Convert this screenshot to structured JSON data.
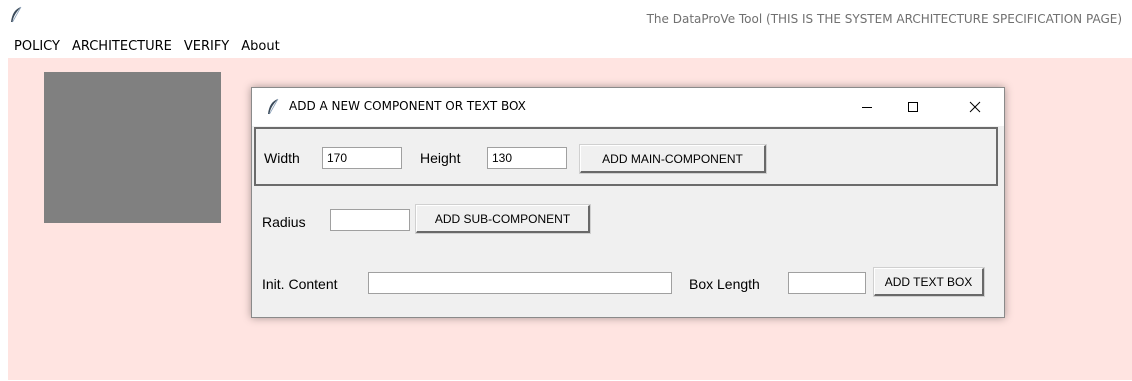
{
  "window": {
    "title": "The DataProVe Tool (THIS IS THE SYSTEM ARCHITECTURE SPECIFICATION PAGE)",
    "icon": "feather-icon"
  },
  "menu": {
    "items": [
      {
        "label": "POLICY"
      },
      {
        "label": "ARCHITECTURE"
      },
      {
        "label": "VERIFY"
      },
      {
        "label": "About"
      }
    ]
  },
  "canvas": {
    "background": "#ffe4e1",
    "shape_color": "#808080"
  },
  "dialog": {
    "title": "ADD A NEW COMPONENT OR TEXT BOX",
    "icon": "feather-icon",
    "main_component": {
      "width_label": "Width",
      "width_value": "170",
      "height_label": "Height",
      "height_value": "130",
      "button": "ADD MAIN-COMPONENT"
    },
    "sub_component": {
      "radius_label": "Radius",
      "radius_value": "",
      "button": "ADD SUB-COMPONENT"
    },
    "text_box": {
      "content_label": "Init. Content",
      "content_value": "",
      "length_label": "Box Length",
      "length_value": "",
      "button": "ADD TEXT BOX"
    }
  }
}
